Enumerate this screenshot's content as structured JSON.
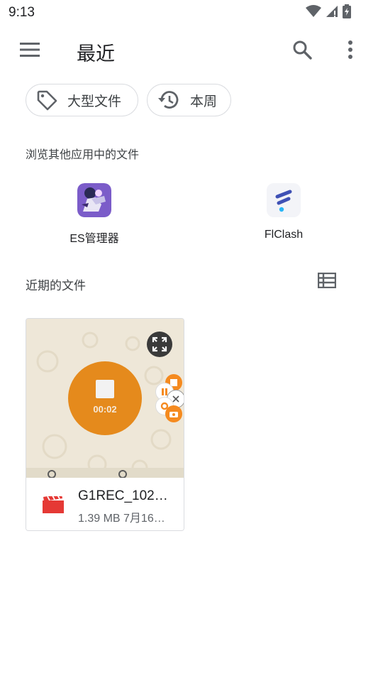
{
  "status_bar": {
    "time": "9:13"
  },
  "app_bar": {
    "title": "最近"
  },
  "chips": [
    {
      "label": "大型文件",
      "icon": "tag-icon"
    },
    {
      "label": "本周",
      "icon": "history-icon"
    }
  ],
  "browse_section": {
    "title": "浏览其他应用中的文件",
    "apps": [
      {
        "label": "ES管理器",
        "icon": "es-manager-app-icon"
      },
      {
        "label": "FlClash",
        "icon": "flclash-app-icon"
      }
    ]
  },
  "recent_section": {
    "title": "近期的文件",
    "files": [
      {
        "name": "G1REC_102…",
        "meta": "1.39 MB 7月16…",
        "icon": "video-file-icon",
        "thumbnail": {
          "timer": "00:02"
        }
      }
    ]
  },
  "colors": {
    "accent_recording": "#e58a1c",
    "video_icon": "#e53935",
    "flclash": "#3f51b5"
  }
}
